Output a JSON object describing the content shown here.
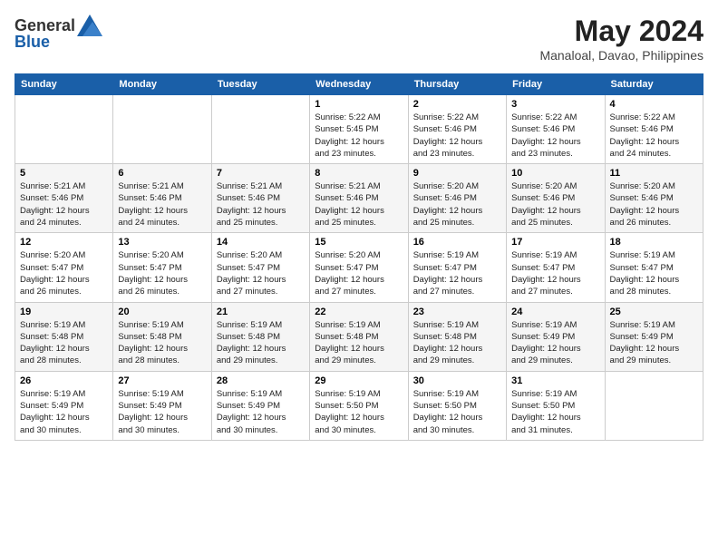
{
  "logo": {
    "general": "General",
    "blue": "Blue"
  },
  "title": {
    "month_year": "May 2024",
    "location": "Manaloal, Davao, Philippines"
  },
  "days_of_week": [
    "Sunday",
    "Monday",
    "Tuesday",
    "Wednesday",
    "Thursday",
    "Friday",
    "Saturday"
  ],
  "weeks": [
    [
      {
        "day": "",
        "info": ""
      },
      {
        "day": "",
        "info": ""
      },
      {
        "day": "",
        "info": ""
      },
      {
        "day": "1",
        "info": "Sunrise: 5:22 AM\nSunset: 5:45 PM\nDaylight: 12 hours\nand 23 minutes."
      },
      {
        "day": "2",
        "info": "Sunrise: 5:22 AM\nSunset: 5:46 PM\nDaylight: 12 hours\nand 23 minutes."
      },
      {
        "day": "3",
        "info": "Sunrise: 5:22 AM\nSunset: 5:46 PM\nDaylight: 12 hours\nand 23 minutes."
      },
      {
        "day": "4",
        "info": "Sunrise: 5:22 AM\nSunset: 5:46 PM\nDaylight: 12 hours\nand 24 minutes."
      }
    ],
    [
      {
        "day": "5",
        "info": "Sunrise: 5:21 AM\nSunset: 5:46 PM\nDaylight: 12 hours\nand 24 minutes."
      },
      {
        "day": "6",
        "info": "Sunrise: 5:21 AM\nSunset: 5:46 PM\nDaylight: 12 hours\nand 24 minutes."
      },
      {
        "day": "7",
        "info": "Sunrise: 5:21 AM\nSunset: 5:46 PM\nDaylight: 12 hours\nand 25 minutes."
      },
      {
        "day": "8",
        "info": "Sunrise: 5:21 AM\nSunset: 5:46 PM\nDaylight: 12 hours\nand 25 minutes."
      },
      {
        "day": "9",
        "info": "Sunrise: 5:20 AM\nSunset: 5:46 PM\nDaylight: 12 hours\nand 25 minutes."
      },
      {
        "day": "10",
        "info": "Sunrise: 5:20 AM\nSunset: 5:46 PM\nDaylight: 12 hours\nand 25 minutes."
      },
      {
        "day": "11",
        "info": "Sunrise: 5:20 AM\nSunset: 5:46 PM\nDaylight: 12 hours\nand 26 minutes."
      }
    ],
    [
      {
        "day": "12",
        "info": "Sunrise: 5:20 AM\nSunset: 5:47 PM\nDaylight: 12 hours\nand 26 minutes."
      },
      {
        "day": "13",
        "info": "Sunrise: 5:20 AM\nSunset: 5:47 PM\nDaylight: 12 hours\nand 26 minutes."
      },
      {
        "day": "14",
        "info": "Sunrise: 5:20 AM\nSunset: 5:47 PM\nDaylight: 12 hours\nand 27 minutes."
      },
      {
        "day": "15",
        "info": "Sunrise: 5:20 AM\nSunset: 5:47 PM\nDaylight: 12 hours\nand 27 minutes."
      },
      {
        "day": "16",
        "info": "Sunrise: 5:19 AM\nSunset: 5:47 PM\nDaylight: 12 hours\nand 27 minutes."
      },
      {
        "day": "17",
        "info": "Sunrise: 5:19 AM\nSunset: 5:47 PM\nDaylight: 12 hours\nand 27 minutes."
      },
      {
        "day": "18",
        "info": "Sunrise: 5:19 AM\nSunset: 5:47 PM\nDaylight: 12 hours\nand 28 minutes."
      }
    ],
    [
      {
        "day": "19",
        "info": "Sunrise: 5:19 AM\nSunset: 5:48 PM\nDaylight: 12 hours\nand 28 minutes."
      },
      {
        "day": "20",
        "info": "Sunrise: 5:19 AM\nSunset: 5:48 PM\nDaylight: 12 hours\nand 28 minutes."
      },
      {
        "day": "21",
        "info": "Sunrise: 5:19 AM\nSunset: 5:48 PM\nDaylight: 12 hours\nand 29 minutes."
      },
      {
        "day": "22",
        "info": "Sunrise: 5:19 AM\nSunset: 5:48 PM\nDaylight: 12 hours\nand 29 minutes."
      },
      {
        "day": "23",
        "info": "Sunrise: 5:19 AM\nSunset: 5:48 PM\nDaylight: 12 hours\nand 29 minutes."
      },
      {
        "day": "24",
        "info": "Sunrise: 5:19 AM\nSunset: 5:49 PM\nDaylight: 12 hours\nand 29 minutes."
      },
      {
        "day": "25",
        "info": "Sunrise: 5:19 AM\nSunset: 5:49 PM\nDaylight: 12 hours\nand 29 minutes."
      }
    ],
    [
      {
        "day": "26",
        "info": "Sunrise: 5:19 AM\nSunset: 5:49 PM\nDaylight: 12 hours\nand 30 minutes."
      },
      {
        "day": "27",
        "info": "Sunrise: 5:19 AM\nSunset: 5:49 PM\nDaylight: 12 hours\nand 30 minutes."
      },
      {
        "day": "28",
        "info": "Sunrise: 5:19 AM\nSunset: 5:49 PM\nDaylight: 12 hours\nand 30 minutes."
      },
      {
        "day": "29",
        "info": "Sunrise: 5:19 AM\nSunset: 5:50 PM\nDaylight: 12 hours\nand 30 minutes."
      },
      {
        "day": "30",
        "info": "Sunrise: 5:19 AM\nSunset: 5:50 PM\nDaylight: 12 hours\nand 30 minutes."
      },
      {
        "day": "31",
        "info": "Sunrise: 5:19 AM\nSunset: 5:50 PM\nDaylight: 12 hours\nand 31 minutes."
      },
      {
        "day": "",
        "info": ""
      }
    ]
  ]
}
